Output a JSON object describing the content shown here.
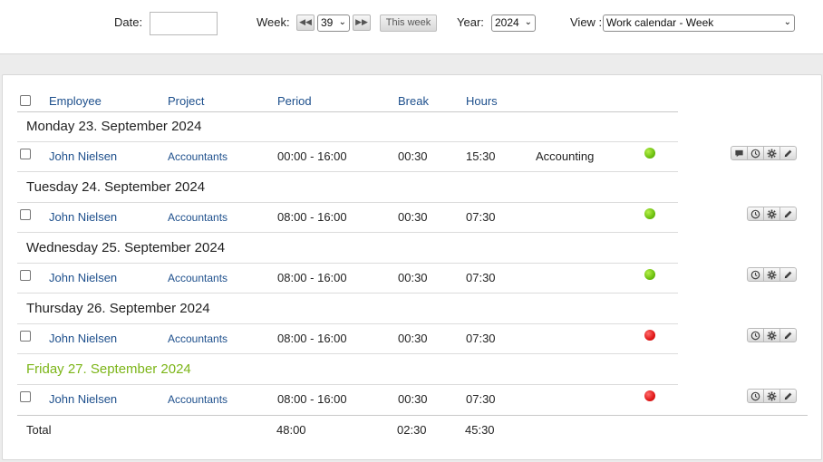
{
  "toolbar": {
    "date_label": "Date:",
    "date_value": "",
    "week_label": "Week:",
    "prev_icon": "double-left-arrow",
    "week_value": "39",
    "next_icon": "double-right-arrow",
    "this_week_label": "This week",
    "year_label": "Year:",
    "year_value": "2024",
    "view_label": "View :",
    "view_value": "Work calendar - Week"
  },
  "table": {
    "headers": {
      "employee": "Employee",
      "project": "Project",
      "period": "Period",
      "break": "Break",
      "hours": "Hours"
    },
    "days": [
      {
        "title": "Monday  23. September 2024",
        "today": false,
        "entry": {
          "employee": "John Nielsen",
          "project": "Accountants",
          "period": "00:00 - 16:00",
          "break": "00:30",
          "hours": "15:30",
          "note": "Accounting",
          "status": "green",
          "actions": [
            "comment-icon",
            "clock-icon",
            "gear-icon",
            "pencil-icon"
          ]
        }
      },
      {
        "title": "Tuesday  24. September 2024",
        "today": false,
        "entry": {
          "employee": "John Nielsen",
          "project": "Accountants",
          "period": "08:00 - 16:00",
          "break": "00:30",
          "hours": "07:30",
          "note": "",
          "status": "green",
          "actions": [
            "clock-icon",
            "gear-icon",
            "pencil-icon"
          ]
        }
      },
      {
        "title": "Wednesday  25. September 2024",
        "today": false,
        "entry": {
          "employee": "John Nielsen",
          "project": "Accountants",
          "period": "08:00 - 16:00",
          "break": "00:30",
          "hours": "07:30",
          "note": "",
          "status": "green",
          "actions": [
            "clock-icon",
            "gear-icon",
            "pencil-icon"
          ]
        }
      },
      {
        "title": "Thursday  26. September 2024",
        "today": false,
        "entry": {
          "employee": "John Nielsen",
          "project": "Accountants",
          "period": "08:00 - 16:00",
          "break": "00:30",
          "hours": "07:30",
          "note": "",
          "status": "red",
          "actions": [
            "clock-icon",
            "gear-icon",
            "pencil-icon"
          ]
        }
      },
      {
        "title": "Friday  27. September 2024",
        "today": true,
        "entry": {
          "employee": "John Nielsen",
          "project": "Accountants",
          "period": "08:00 - 16:00",
          "break": "00:30",
          "hours": "07:30",
          "note": "",
          "status": "red",
          "actions": [
            "clock-icon",
            "gear-icon",
            "pencil-icon"
          ]
        }
      }
    ],
    "total": {
      "label": "Total",
      "period": "48:00",
      "break": "02:30",
      "hours": "45:30"
    }
  },
  "colors": {
    "link": "#1d4f8c",
    "today": "#7cb518",
    "status_green": "#6cc00f",
    "status_red": "#e01818"
  }
}
